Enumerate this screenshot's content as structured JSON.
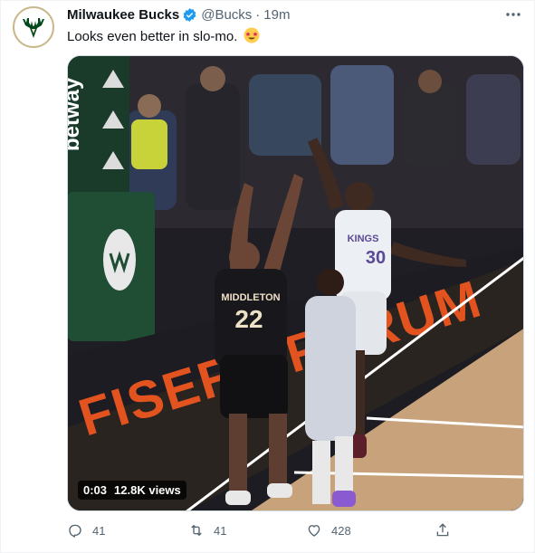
{
  "tweet": {
    "author_name": "Milwaukee Bucks",
    "handle": "@Bucks",
    "separator": "·",
    "time": "19m",
    "text": "Looks even better in slo-mo.",
    "video": {
      "timestamp": "0:03",
      "views": "12.8K views",
      "court_text": "FISERV FORUM",
      "sign_text": "betway",
      "jersey_home_name": "MIDDLETON",
      "jersey_home_number": "22",
      "jersey_away_name": "KINGS",
      "jersey_away_number": "30"
    },
    "actions": {
      "replies": "41",
      "retweets": "41",
      "likes": "428"
    }
  },
  "colors": {
    "bucks_green": "#00471b",
    "bucks_cream": "#eee1c6",
    "verified_blue": "#1d9bf0",
    "muted_text": "#536471"
  },
  "icons": [
    "bucks-logo-icon",
    "verified-badge-icon",
    "more-icon",
    "star-struck-emoji-icon",
    "reply-icon",
    "retweet-icon",
    "like-icon",
    "share-icon"
  ]
}
